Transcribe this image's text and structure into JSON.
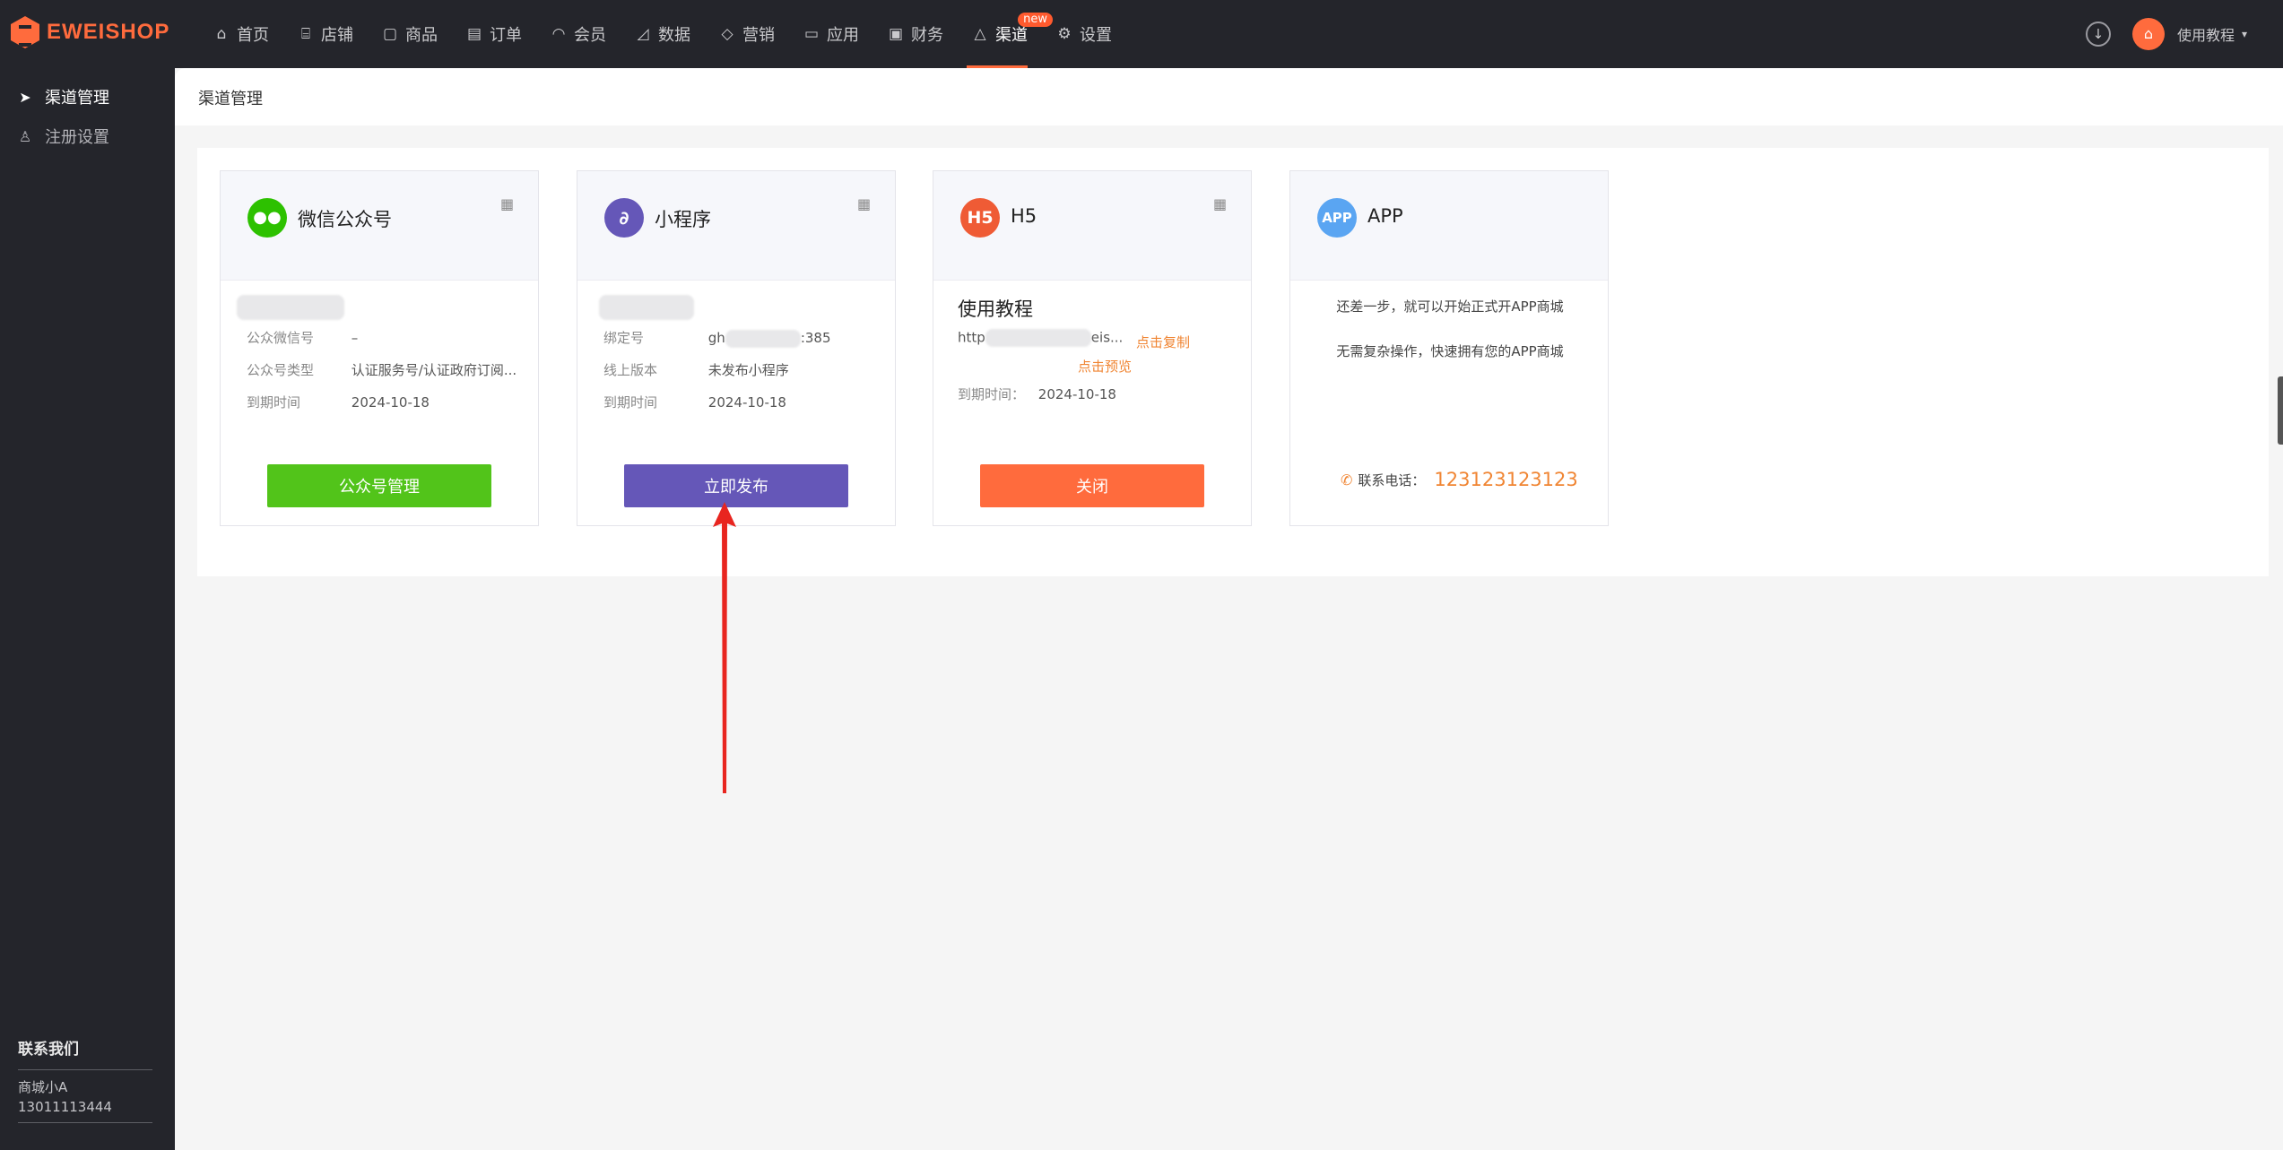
{
  "brand": {
    "name": "EWEISHOP"
  },
  "nav": {
    "items": [
      {
        "label": "首页",
        "icon": "home-icon"
      },
      {
        "label": "店铺",
        "icon": "store-icon"
      },
      {
        "label": "商品",
        "icon": "bag-icon"
      },
      {
        "label": "订单",
        "icon": "order-icon"
      },
      {
        "label": "会员",
        "icon": "user-icon"
      },
      {
        "label": "数据",
        "icon": "chart-icon"
      },
      {
        "label": "营销",
        "icon": "tag-icon"
      },
      {
        "label": "应用",
        "icon": "box-icon"
      },
      {
        "label": "财务",
        "icon": "finance-icon"
      },
      {
        "label": "渠道",
        "icon": "channel-icon",
        "active": true,
        "badge": "new"
      },
      {
        "label": "设置",
        "icon": "gear-icon"
      }
    ],
    "user": "使用教程"
  },
  "sidebar": {
    "items": [
      {
        "label": "渠道管理",
        "icon": "send-icon",
        "active": true
      },
      {
        "label": "注册设置",
        "icon": "users-icon"
      }
    ],
    "contact": {
      "title": "联系我们",
      "name": "商城小A",
      "phone": "13011113444"
    }
  },
  "page": {
    "title": "渠道管理"
  },
  "cards": {
    "wechat": {
      "title": "微信公众号",
      "rows": [
        {
          "key": "公众微信号",
          "value": "–"
        },
        {
          "key": "公众号类型",
          "value": "认证服务号/认证政府订阅..."
        },
        {
          "key": "到期时间",
          "value": "2024-10-18"
        }
      ],
      "button": "公众号管理"
    },
    "mini": {
      "title": "小程序",
      "rows": [
        {
          "key": "绑定号",
          "value_prefix": "gh",
          "value_suffix": ":385"
        },
        {
          "key": "线上版本",
          "value": "未发布小程序"
        },
        {
          "key": "到期时间",
          "value": "2024-10-18"
        }
      ],
      "button": "立即发布"
    },
    "h5": {
      "title": "H5",
      "icon_text": "H5",
      "subtitle": "使用教程",
      "url_prefix": "http",
      "url_suffix": "eis...",
      "copy_link": "点击复制",
      "preview_link": "点击预览",
      "expire_label": "到期时间：",
      "expire_value": "2024-10-18",
      "button": "关闭"
    },
    "app": {
      "title": "APP",
      "icon_text": "APP",
      "line1": "还差一步，就可以开始正式开APP商城",
      "line2": "无需复杂操作，快速拥有您的APP商城",
      "phone_label": "联系电话：",
      "phone": "123123123123"
    }
  },
  "colors": {
    "accent": "#ff6b3d",
    "topbar": "#24252b",
    "green": "#52c41a",
    "purple": "#6557b8",
    "orange_link": "#f08533",
    "arrow": "#e8251f"
  }
}
